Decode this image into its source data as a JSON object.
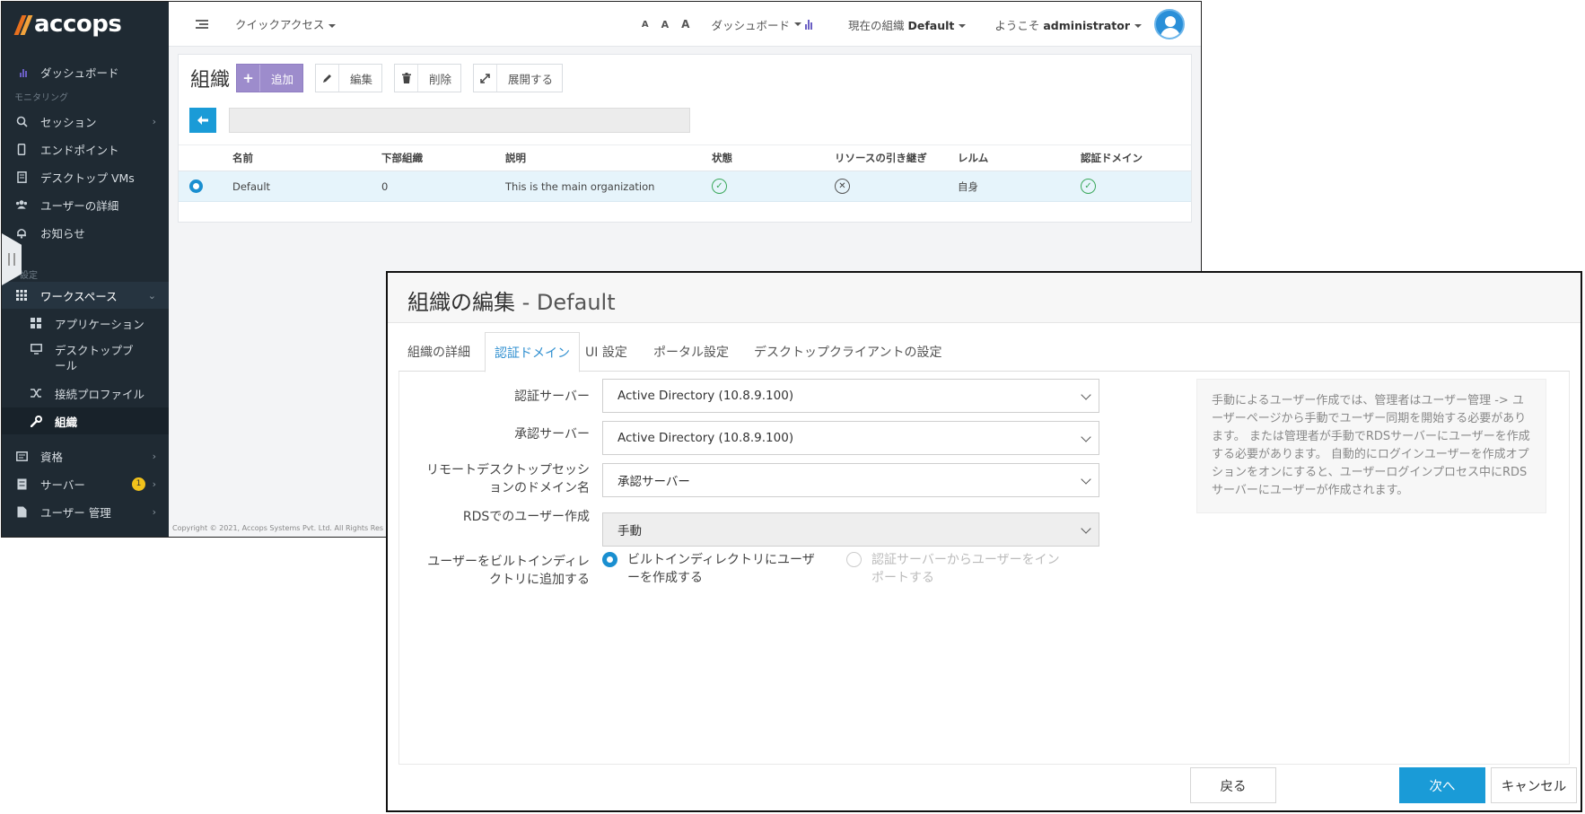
{
  "app": {
    "logo_text": "accops",
    "topbar": {
      "quick_access": "クイックアクセス",
      "font_sizes": [
        "A",
        "A",
        "A"
      ],
      "dashboard": "ダッシュボード",
      "current_org_prefix": "現在の組織",
      "current_org": "Default",
      "welcome_prefix": "ようこそ",
      "username": "administrator"
    },
    "sidebar": {
      "dashboard": "ダッシュボード",
      "section_monitoring": "モニタリング",
      "sessions": "セッション",
      "endpoints": "エンドポイント",
      "desktop_vms": "デスクトップ VMs",
      "user_details": "ユーザーの詳細",
      "notifications": "お知らせ",
      "section_settings": "設定",
      "workspace": "ワークスペース",
      "applications": "アプリケーション",
      "desktop_pool": "デスクトップブール",
      "connection_profiles": "接続プロファイル",
      "organizations": "組織",
      "credentials": "資格",
      "servers": "サーバー",
      "servers_badge": "1",
      "user_management": "ユーザー 管理"
    },
    "page": {
      "title": "組織",
      "add": "追加",
      "edit": "編集",
      "delete": "削除",
      "expand": "展開する"
    },
    "table": {
      "headers": [
        "名前",
        "下部組織",
        "説明",
        "状態",
        "リソースの引き継ぎ",
        "レルム",
        "認証ドメイン"
      ],
      "rows": [
        {
          "name": "Default",
          "sub_orgs": "0",
          "description": "This is the main organization",
          "status": "enabled",
          "inherit": "disabled",
          "realm": "自身",
          "auth_domain": "enabled"
        }
      ]
    },
    "copyright": "Copyright © 2021, Accops Systems Pvt. Ltd. All Rights Res"
  },
  "dialog": {
    "title": "組織の編集",
    "title_suffix": "- Default",
    "tabs": [
      "組織の詳細",
      "認証ドメイン",
      "UI 設定",
      "ポータル設定",
      "デスクトップクライアントの設定"
    ],
    "active_tab": "認証ドメイン",
    "fields": {
      "auth_server_label": "認証サーバー",
      "auth_server_value": "Active Directory (10.8.9.100)",
      "authz_server_label": "承認サーバー",
      "authz_server_value": "Active Directory (10.8.9.100)",
      "rd_domain_label_1": "リモートデスクトップセッシ",
      "rd_domain_label_2": "ョンのドメイン名",
      "rd_domain_value": "承認サーバー",
      "rds_create_label": "RDSでのユーザー作成",
      "rds_create_value": "手動",
      "builtin_label_1": "ユーザーをビルトインディレ",
      "builtin_label_2": "クトリに追加する",
      "radio_create_1": "ビルトインディレクトリにユーザ",
      "radio_create_2": "ーを作成する",
      "radio_import_1": "認証サーバーからユーザーをイン",
      "radio_import_2": "ポートする"
    },
    "help_text": "手動によるユーザー作成では、管理者はユーザー管理 -> ユーザーページから手動でユーザー同期を開始する必要があります。 または管理者が手動でRDSサーバーにユーザーを作成する必要があります。 自動的にログインユーザーを作成オプションをオンにすると、ユーザーログインプロセス中にRDSサーバーにユーザーが作成されます。",
    "buttons": {
      "back": "戻る",
      "next": "次へ",
      "cancel": "キャンセル"
    }
  },
  "colors": {
    "accent_blue": "#1a9bd7",
    "sidebar_bg": "#1f2a33",
    "add_button": "#9d8ccc",
    "status_green": "#3aa85b"
  }
}
